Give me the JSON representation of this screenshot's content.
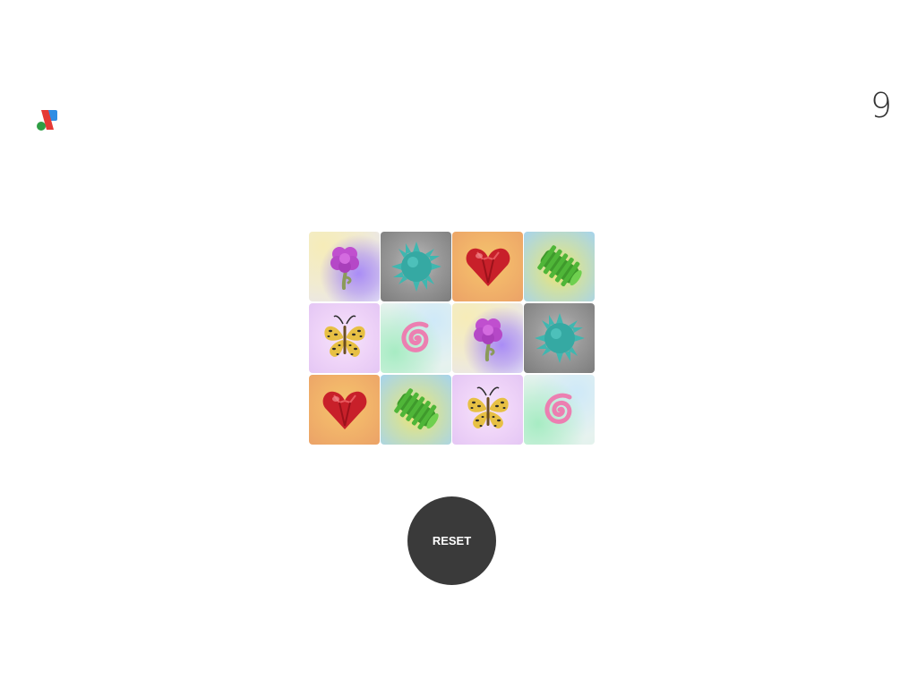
{
  "header": {
    "logo_icon": "abstract-shapes-logo",
    "moves_count": "9"
  },
  "board": {
    "rows": 3,
    "cols": 4,
    "tiles": [
      {
        "icon": "purple-flower"
      },
      {
        "icon": "teal-spiky-ball"
      },
      {
        "icon": "red-heart-gem"
      },
      {
        "icon": "green-ridged-cylinder"
      },
      {
        "icon": "leopard-butterfly"
      },
      {
        "icon": "pink-spiral"
      },
      {
        "icon": "purple-flower"
      },
      {
        "icon": "teal-spiky-ball"
      },
      {
        "icon": "red-heart-gem"
      },
      {
        "icon": "green-ridged-cylinder"
      },
      {
        "icon": "leopard-butterfly"
      },
      {
        "icon": "pink-spiral"
      }
    ]
  },
  "controls": {
    "reset_label": "RESET"
  },
  "colors": {
    "reset_button": "#3a3a3a",
    "counter_text": "#333333"
  }
}
